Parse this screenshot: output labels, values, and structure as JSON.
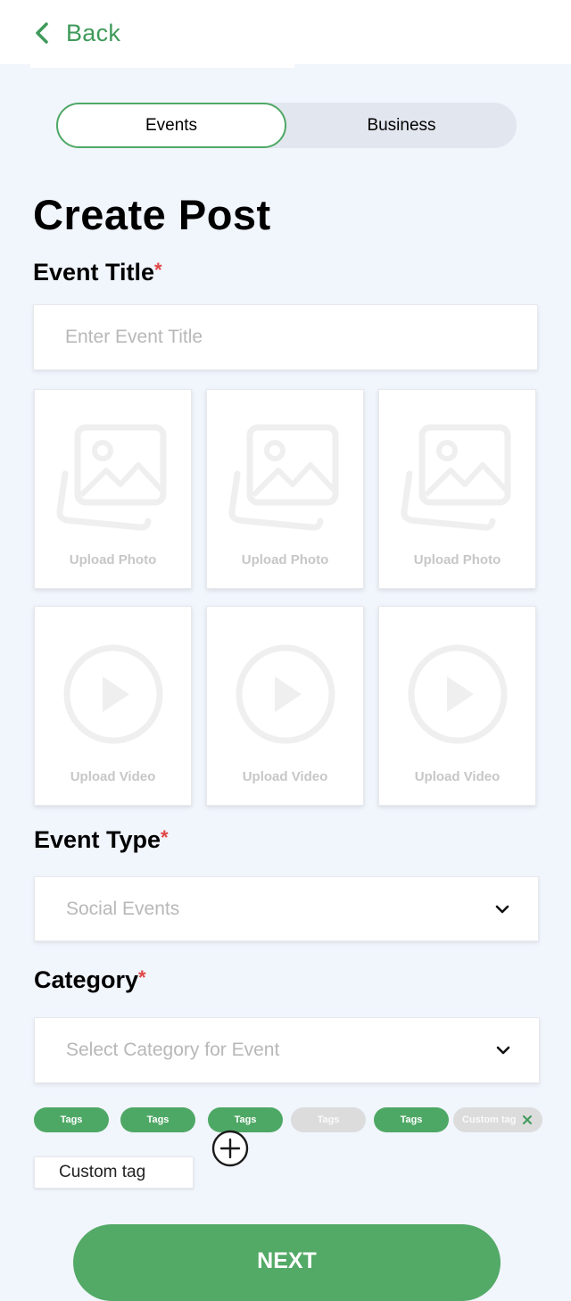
{
  "header": {
    "back_label": "Back"
  },
  "tabs": [
    {
      "label": "Events"
    },
    {
      "label": "Business"
    }
  ],
  "page_title": "Create Post",
  "event_title": {
    "label": "Event Title",
    "required_mark": "*",
    "placeholder": "Enter Event Title"
  },
  "media": {
    "photos": [
      {
        "label": "Upload Photo"
      },
      {
        "label": "Upload Photo"
      },
      {
        "label": "Upload Photo"
      }
    ],
    "videos": [
      {
        "label": "Upload Video"
      },
      {
        "label": "Upload Video"
      },
      {
        "label": "Upload Video"
      }
    ]
  },
  "event_type": {
    "label": "Event Type",
    "required_mark": "*",
    "value": "Social Events"
  },
  "category": {
    "label": "Category",
    "required_mark": "*",
    "placeholder": "Select Category for Event"
  },
  "tags": [
    {
      "label": "Tags",
      "state": "selected"
    },
    {
      "label": "Tags",
      "state": "selected"
    },
    {
      "label": "Tags",
      "state": "selected"
    },
    {
      "label": "Tags",
      "state": "unselected"
    },
    {
      "label": "Tags",
      "state": "selected"
    },
    {
      "label": "Custom tag",
      "state": "custom"
    }
  ],
  "custom_tag_input": {
    "value": "Custom tag"
  },
  "next_label": "NEXT",
  "colors": {
    "accent": "#4ea865",
    "background": "#f1f5fc",
    "required": "#e04545"
  }
}
